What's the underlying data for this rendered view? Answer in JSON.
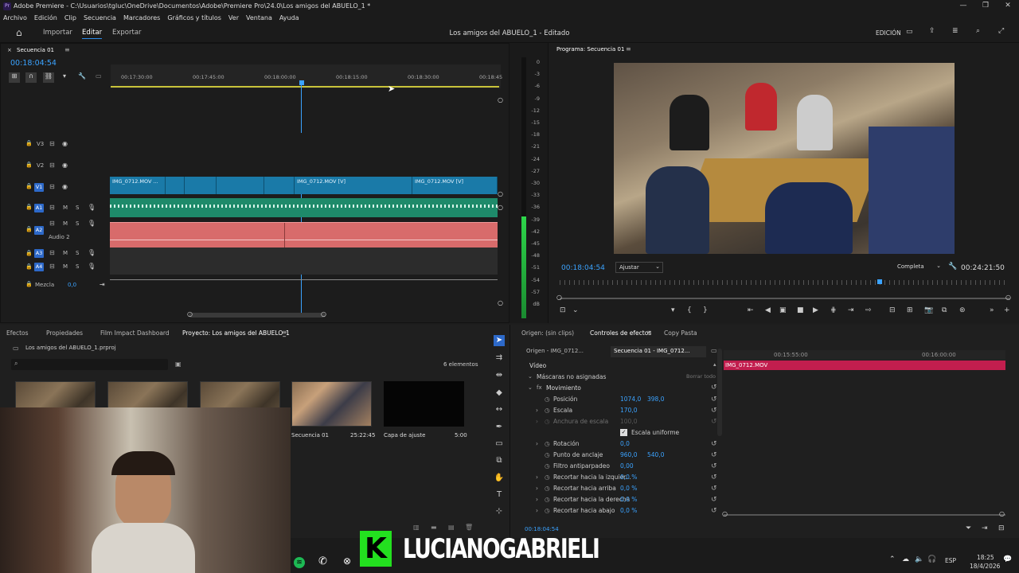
{
  "window": {
    "title": "Adobe Premiere - C:\\Usuarios\\tgluc\\OneDrive\\Documentos\\Adobe\\Premiere Pro\\24.0\\Los amigos del ABUELO_1 *",
    "app_icon": "Pr"
  },
  "menu": [
    "Archivo",
    "Edición",
    "Clip",
    "Secuencia",
    "Marcadores",
    "Gráficos y títulos",
    "Ver",
    "Ventana",
    "Ayuda"
  ],
  "workspace": {
    "tabs": [
      "Importar",
      "Editar",
      "Exportar"
    ],
    "active": "Editar",
    "doc_title": "Los amigos del ABUELO_1 - Editado",
    "mode": "EDICIÓN"
  },
  "timeline": {
    "tab": "Secuencia 01",
    "timecode": "00:18:04:54",
    "ruler": [
      "00:17:30:00",
      "00:17:45:00",
      "00:18:00:00",
      "00:18:15:00",
      "00:18:30:00",
      "00:18:45"
    ],
    "tracks": {
      "v3": "V3",
      "v2": "V2",
      "v1": "V1",
      "a1": "A1",
      "a2": "A2",
      "a2_name": "Audio 2",
      "a3": "A3",
      "a4": "A4",
      "m": "M",
      "s": "S",
      "mix": "Mezcla",
      "mix_val": "0,0"
    },
    "clips": {
      "c1": "IMG_0712.MOV ...",
      "c2": "IMG_0712.MOV [V]",
      "c3": "IMG_0712.MOV [V]",
      "fx": "fx"
    }
  },
  "meter": {
    "ticks": [
      "0",
      "-3",
      "-6",
      "-9",
      "-12",
      "-15",
      "-18",
      "-21",
      "-24",
      "-27",
      "-30",
      "-33",
      "-36",
      "-39",
      "-42",
      "-45",
      "-48",
      "-51",
      "-54",
      "-57",
      "dB"
    ]
  },
  "program": {
    "title": "Programa: Secuencia 01",
    "timecode": "00:18:04:54",
    "fit": "Ajustar",
    "quality": "Completa",
    "duration": "00:24:21:50"
  },
  "project": {
    "tabs": [
      "Efectos",
      "Propiedades",
      "Film Impact Dashboard",
      "Proyecto: Los amigos del ABUELO_1"
    ],
    "file": "Los amigos del ABUELO_1.prproj",
    "count": "6 elementos",
    "items": [
      {
        "name": "Secuencia 01",
        "dur": "25:22:45"
      },
      {
        "name": "Capa de ajuste",
        "dur": "5:00"
      }
    ]
  },
  "effects": {
    "tabs": [
      "Origen: (sin clips)",
      "Controles de efectos",
      "Copy Pasta"
    ],
    "subtabs": [
      "Origen - IMG_0712...",
      "Secuencia 01 - IMG_0712..."
    ],
    "section": "Vídeo",
    "masks": "Máscaras no asignadas",
    "clear": "Borrar todo",
    "motion": "Movimiento",
    "rows": [
      {
        "name": "Posición",
        "v1": "1074,0",
        "v2": "398,0"
      },
      {
        "name": "Escala",
        "v1": "170,0",
        "v2": ""
      },
      {
        "name": "Anchura de escala",
        "v1": "100,0",
        "v2": ""
      },
      {
        "name": "Escala uniforme",
        "v1": "",
        "v2": ""
      },
      {
        "name": "Rotación",
        "v1": "0,0",
        "v2": ""
      },
      {
        "name": "Punto de anclaje",
        "v1": "960,0",
        "v2": "540,0"
      },
      {
        "name": "Filtro antiparpadeo",
        "v1": "0,00",
        "v2": ""
      },
      {
        "name": "Recortar hacia la izquier...",
        "v1": "0,0 %",
        "v2": ""
      },
      {
        "name": "Recortar hacia arriba",
        "v1": "0,0 %",
        "v2": ""
      },
      {
        "name": "Recortar hacia la derecha",
        "v1": "0,0 %",
        "v2": ""
      },
      {
        "name": "Recortar hacia abajo",
        "v1": "0,0 %",
        "v2": ""
      }
    ],
    "mini_ruler": [
      "00:15:55:00",
      "00:16:00:00"
    ],
    "mini_clip": "IMG_0712.MOV",
    "timecode": "00:18:04:54"
  },
  "overlay": {
    "streamer": "LUCIANOGABRIELI",
    "logo": "K"
  },
  "taskbar": {
    "lang": "ESP",
    "time": "18:25",
    "date": "18/4/2026"
  },
  "colors": {
    "accent": "#2d8ceb",
    "clip": "#1a7aa8",
    "audio": "#1e8a6a",
    "audio2": "#d86b6b",
    "fx_bar": "#c21e4e",
    "overlay_green": "#23e01f"
  }
}
